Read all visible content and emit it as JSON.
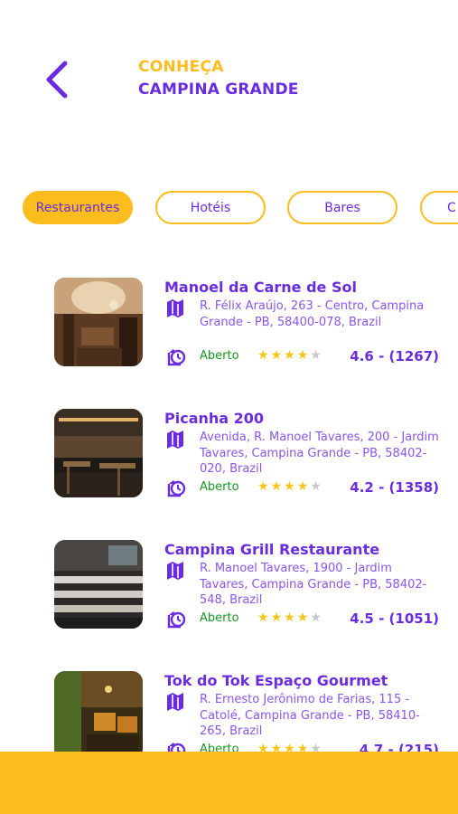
{
  "header": {
    "title_line1": "CONHEÇA",
    "title_line2": "CAMPINA GRANDE",
    "back_icon": "chevron-left-icon"
  },
  "colors": {
    "primary": "#6a2ce0",
    "accent": "#fbbd1e",
    "open_status": "#19941f",
    "star": "#f5c518"
  },
  "categories": [
    {
      "label": "Restaurantes",
      "active": true
    },
    {
      "label": "Hotéis",
      "active": false
    },
    {
      "label": "Bares",
      "active": false
    },
    {
      "label": "C",
      "active": false
    }
  ],
  "places": [
    {
      "name": "Manoel da Carne de Sol",
      "address": "R. Félix Araújo, 263 - Centro, Campina Grande - PB, 58400-078, Brazil",
      "status": "Aberto",
      "stars": 4,
      "rating": "4.6 - (1267)"
    },
    {
      "name": "Picanha 200",
      "address": "Avenida, R. Manoel Tavares, 200 - Jardim Tavares, Campina Grande - PB, 58402-020, Brazil",
      "status": "Aberto",
      "stars": 4,
      "rating": "4.2 - (1358)"
    },
    {
      "name": "Campina Grill Restaurante",
      "address": "R. Manoel Tavares, 1900 - Jardim Tavares, Campina Grande - PB, 58402-548, Brazil",
      "status": "Aberto",
      "stars": 4,
      "rating": "4.5 - (1051)"
    },
    {
      "name": "Tok do Tok Espaço Gourmet",
      "address": "R. Ernesto Jerônimo de Farias, 115 - Catolé, Campina Grande - PB, 58410-265, Brazil",
      "status": "Aberto",
      "stars": 4,
      "rating": "4.7 - (215)"
    }
  ]
}
